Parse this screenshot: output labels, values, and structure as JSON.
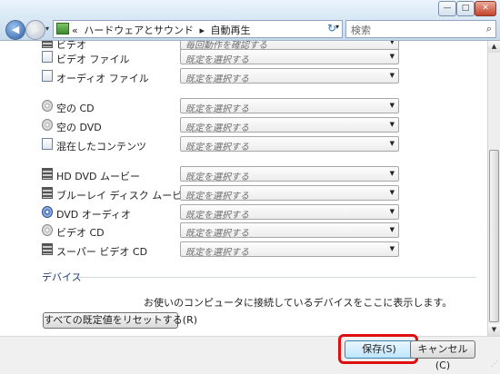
{
  "titlebar": {
    "min": "—",
    "max": "□",
    "close": "✕"
  },
  "nav": {
    "back_icon": "◀",
    "forward_icon": "▶",
    "dropdown": "▾",
    "breadcrumb": [
      "«",
      "ハードウェアとサウンド",
      "▸",
      "自動再生"
    ],
    "refresh": "↻",
    "search_placeholder": "検索",
    "search_icon": "⌕"
  },
  "rows": [
    {
      "label": "ビデオ",
      "value": "毎回動作を確認する",
      "icon": "film-icon"
    },
    {
      "label": "ビデオ ファイル",
      "value": "既定を選択する",
      "icon": "file-icon"
    },
    {
      "label": "オーディオ ファイル",
      "value": "既定を選択する",
      "icon": "file-icon"
    },
    {
      "label": "空の CD",
      "value": "既定を選択する",
      "icon": "disc-icon"
    },
    {
      "label": "空の DVD",
      "value": "既定を選択する",
      "icon": "disc-icon"
    },
    {
      "label": "混在したコンテンツ",
      "value": "既定を選択する",
      "icon": "file-icon"
    },
    {
      "label": "HD DVD ムービー",
      "value": "既定を選択する",
      "icon": "film-icon"
    },
    {
      "label": "ブルーレイ ディスク ムービー",
      "value": "既定を選択する",
      "icon": "film-icon"
    },
    {
      "label": "DVD オーディオ",
      "value": "既定を選択する",
      "icon": "dvd-icon"
    },
    {
      "label": "ビデオ CD",
      "value": "既定を選択する",
      "icon": "disc-icon"
    },
    {
      "label": "スーパー ビデオ CD",
      "value": "既定を選択する",
      "icon": "film-icon"
    }
  ],
  "dropdown_arrow": "▼",
  "devices": {
    "heading": "デバイス",
    "message": "お使いのコンピュータに接続しているデバイスをここに表示します。"
  },
  "buttons": {
    "reset": "すべての既定値をリセットする(R)",
    "save": "保存(S)",
    "cancel": "キャンセル(C)"
  },
  "scrollbar": {
    "up": "▲",
    "down": "▼"
  }
}
